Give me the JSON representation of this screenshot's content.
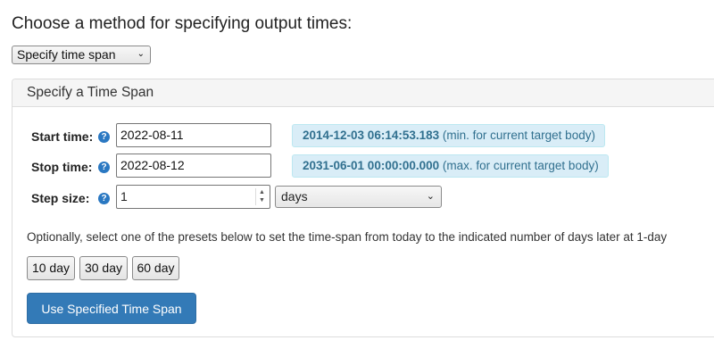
{
  "method": {
    "heading": "Choose a method for specifying output times:",
    "selected": "Specify time span",
    "chevron_icon": "chevron-down"
  },
  "panel": {
    "title": "Specify a Time Span",
    "start": {
      "label": "Start time:",
      "value": "2022-08-11",
      "range_value": "2014-12-03 06:14:53.183",
      "range_note": "(min. for current target body)"
    },
    "stop": {
      "label": "Stop time:",
      "value": "2022-08-12",
      "range_value": "2031-06-01 00:00:00.000",
      "range_note": "(max. for current target body)"
    },
    "step": {
      "label": "Step size:",
      "value": "1",
      "unit": "days"
    },
    "help_icon_glyph": "?",
    "optional_text": "Optionally, select one of the presets below to set the time-span from today to the indicated number of days later at 1-day",
    "presets": [
      "10 day",
      "30 day",
      "60 day"
    ],
    "submit_label": "Use Specified Time Span"
  },
  "colors": {
    "primary": "#337ab7",
    "info_bg": "#d9edf7",
    "info_text": "#31708f",
    "help_icon": "#2a78c2"
  }
}
